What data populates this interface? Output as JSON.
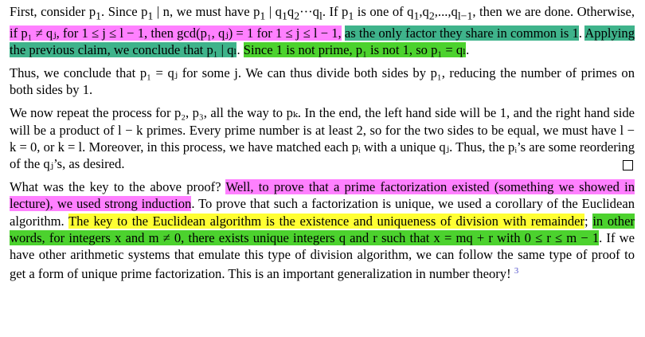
{
  "para1": {
    "s1": "First, consider p",
    "s1sub": "1",
    "s2": ". Since p",
    "s3": " | n, we must have p",
    "s4": " | q",
    "s5": "q",
    "s6": "···q",
    "s6sub": "l",
    "s7": ". If p",
    "s8": " is one of q",
    "s9": ",q",
    "s10": ",...,q",
    "s10sub": "l−1",
    "s11": ", then we are done. Otherwise, ",
    "pink": "if p₁ ≠ qⱼ, for 1 ≤ j ≤ l − 1, then gcd(p₁, qⱼ) = 1 for 1 ≤ j ≤ l − 1,",
    "teal1": "as the only factor they share in common is 1",
    "teal2": "Applying the previous claim, we conclude that p₁ | qₗ",
    "green": "Since 1 is not prime, p₁ is not 1, so p₁ = qₗ"
  },
  "para2": "Thus, we conclude that p₁ = qⱼ for some j. We can thus divide both sides by p₁, reducing the number of primes on both sides by 1.",
  "para3": "We now repeat the process for p₂, p₃, all the way to pₖ. In the end, the left hand side will be 1, and the right hand side will be a product of l − k primes. Every prime number is at least 2, so for the two sides to be equal, we must have l − k = 0, or k = l. Moreover, in this process, we have matched each pᵢ with a unique qⱼ. Thus, the pᵢ’s are some reordering of the qⱼ’s, as desired.",
  "para4": {
    "plain1": "What was the key to the above proof? ",
    "pink": "Well, to prove that a prime factorization existed (something we showed in lecture), we used strong induction",
    "plain2": ". To prove that such a factorization is unique, we used a corollary of the Euclidean algorithm. ",
    "yellow": "The key to the Euclidean algorithm is the existence and uniqueness of division with remainder",
    "plain3": "; ",
    "green": "in other words, for integers x and m ≠ 0, there exists unique integers q and r such that x = mq + r with 0 ≤ r ≤ m − 1",
    "plain4": ". If we have other arithmetic systems that emulate this type of division algorithm, we can follow the same type of proof to get a form of unique prime factorization. This is an important generalization in number theory!",
    "footnote": "3"
  }
}
